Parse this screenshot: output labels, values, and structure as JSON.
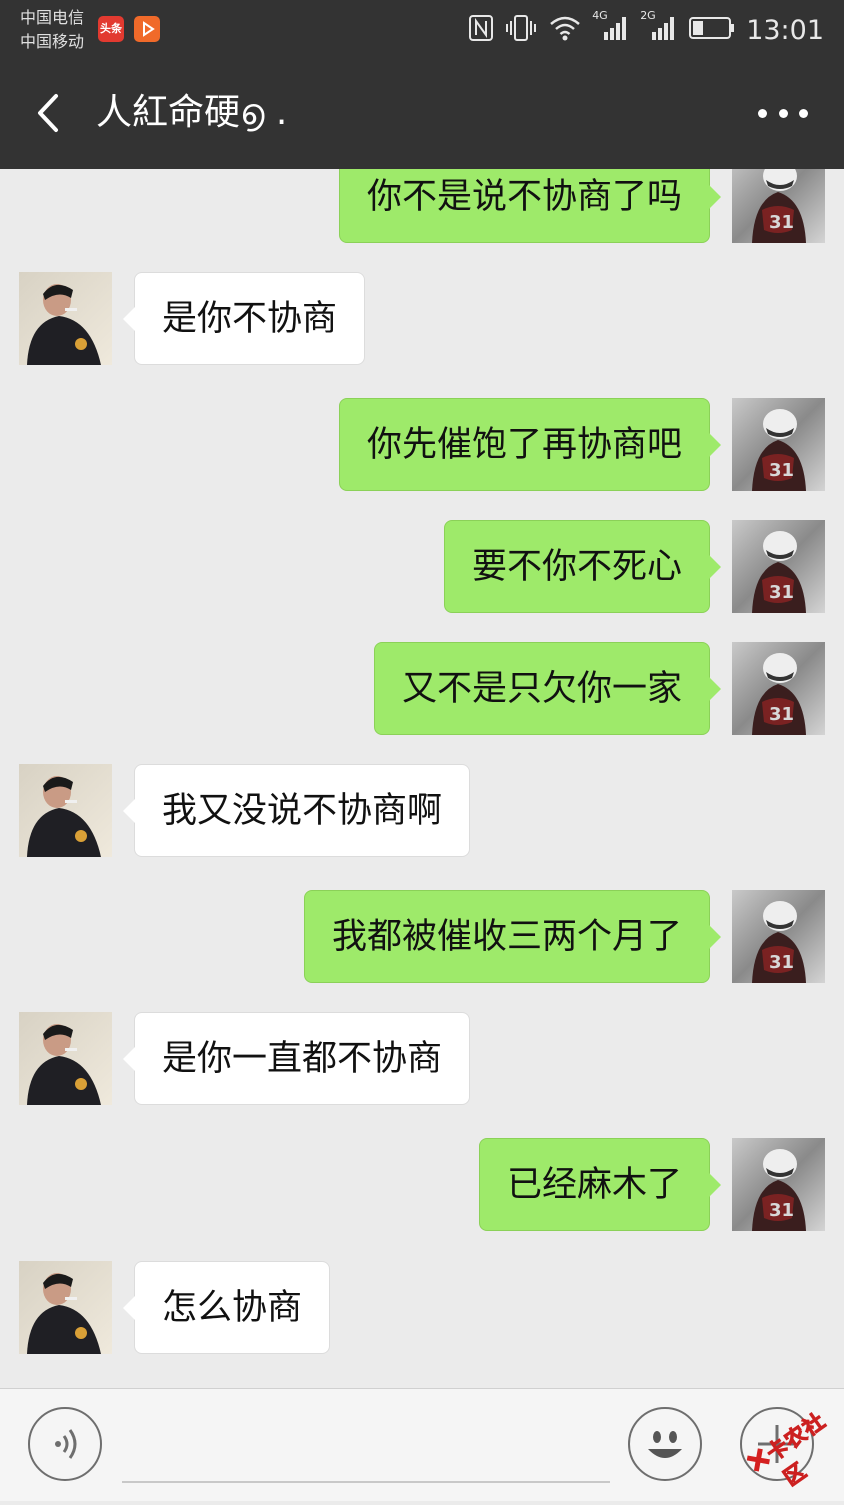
{
  "status_bar": {
    "carrier_1": "中国电信",
    "carrier_2": "中国移动",
    "app_badge_1": "头条",
    "network_1": "4G",
    "network_2": "2G",
    "time": "13:01"
  },
  "header": {
    "title": "人紅命硬൭ .",
    "back_icon": "chevron-left",
    "more_icon": "three-dots"
  },
  "messages": [
    {
      "side": "right",
      "text": "你不是说不协商了吗"
    },
    {
      "side": "left",
      "text": "是你不协商"
    },
    {
      "side": "right",
      "text": "你先催饱了再协商吧"
    },
    {
      "side": "right",
      "text": "要不你不死心"
    },
    {
      "side": "right",
      "text": "又不是只欠你一家"
    },
    {
      "side": "left",
      "text": "我又没说不协商啊"
    },
    {
      "side": "right",
      "text": "我都被催收三两个月了"
    },
    {
      "side": "left",
      "text": "是你一直都不协商"
    },
    {
      "side": "right",
      "text": "已经麻木了"
    },
    {
      "side": "left",
      "text": "怎么协商"
    }
  ],
  "input_bar": {
    "voice_icon": "voice",
    "emoji_icon": "smiley",
    "plus_icon": "plus"
  },
  "watermark": "卡农社区",
  "colors": {
    "bar": "#333333",
    "chat_bg": "#ebebeb",
    "bubble_self": "#9eea6a",
    "bubble_other": "#ffffff"
  }
}
